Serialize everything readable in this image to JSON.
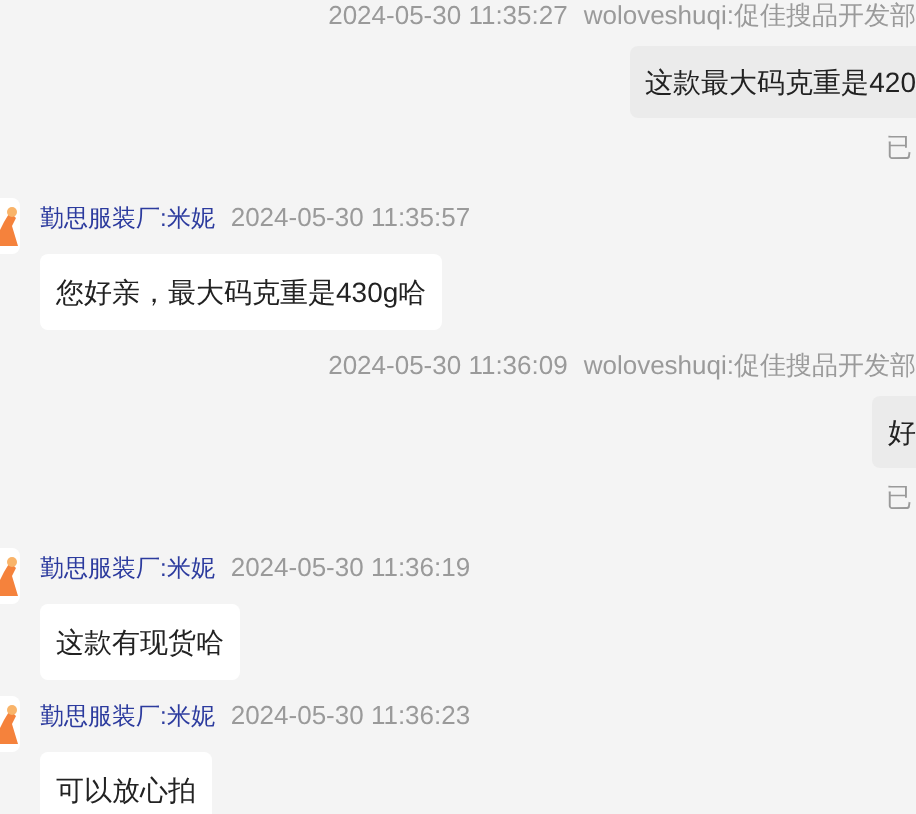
{
  "messages": [
    {
      "kind": "outgoing",
      "time": "2024-05-30 11:35:27",
      "sender": "woloveshuqi:促佳搜品开发部",
      "text": "这款最大码克重是420",
      "status": "已"
    },
    {
      "kind": "incoming",
      "sender": "勤思服装厂:米妮",
      "time": "2024-05-30 11:35:57",
      "text": "您好亲，最大码克重是430g哈"
    },
    {
      "kind": "outgoing",
      "time": "2024-05-30 11:36:09",
      "sender": "woloveshuqi:促佳搜品开发部",
      "text": "好",
      "status": "已"
    },
    {
      "kind": "incoming",
      "sender": "勤思服装厂:米妮",
      "time": "2024-05-30 11:36:19",
      "text": "这款有现货哈"
    },
    {
      "kind": "incoming",
      "sender": "勤思服装厂:米妮",
      "time": "2024-05-30 11:36:23",
      "text": "可以放心拍"
    }
  ]
}
